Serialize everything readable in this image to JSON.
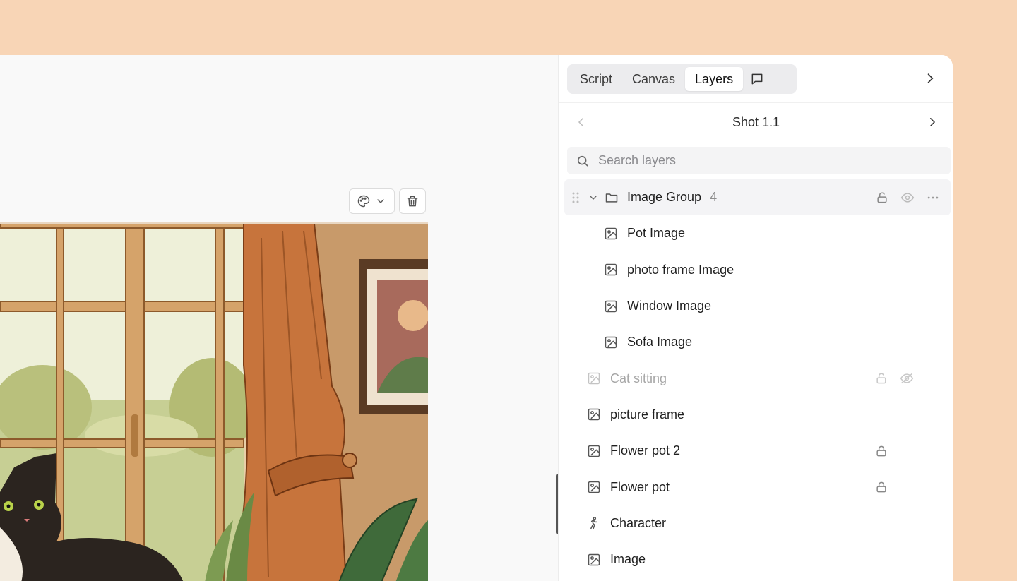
{
  "tabs": [
    {
      "label": "Script",
      "active": false
    },
    {
      "label": "Canvas",
      "active": false
    },
    {
      "label": "Layers",
      "active": true
    }
  ],
  "shot": {
    "title": "Shot 1.1"
  },
  "search": {
    "placeholder": "Search layers",
    "value": ""
  },
  "layer_group": {
    "label": "Image Group",
    "count": "4"
  },
  "group_children": [
    {
      "label": "Pot Image"
    },
    {
      "label": "photo frame Image"
    },
    {
      "label": "Window Image"
    },
    {
      "label": "Sofa Image"
    }
  ],
  "layers": [
    {
      "label": "Cat sitting",
      "icon": "image-icon",
      "locked": true,
      "hidden": true
    },
    {
      "label": "picture frame",
      "icon": "image-icon",
      "locked": false,
      "hidden": false
    },
    {
      "label": "Flower pot 2",
      "icon": "image-icon",
      "locked": true,
      "hidden": false
    },
    {
      "label": "Flower pot",
      "icon": "image-icon",
      "locked": true,
      "hidden": false
    },
    {
      "label": "Character",
      "icon": "walking-person-icon",
      "locked": false,
      "hidden": false
    },
    {
      "label": "Image",
      "icon": "image-icon",
      "locked": false,
      "hidden": false
    }
  ],
  "colors": {
    "background": "#f8d5b6",
    "panel": "#ffffff",
    "tabs_bg": "#ececee",
    "muted_text": "#a6a6a6"
  }
}
